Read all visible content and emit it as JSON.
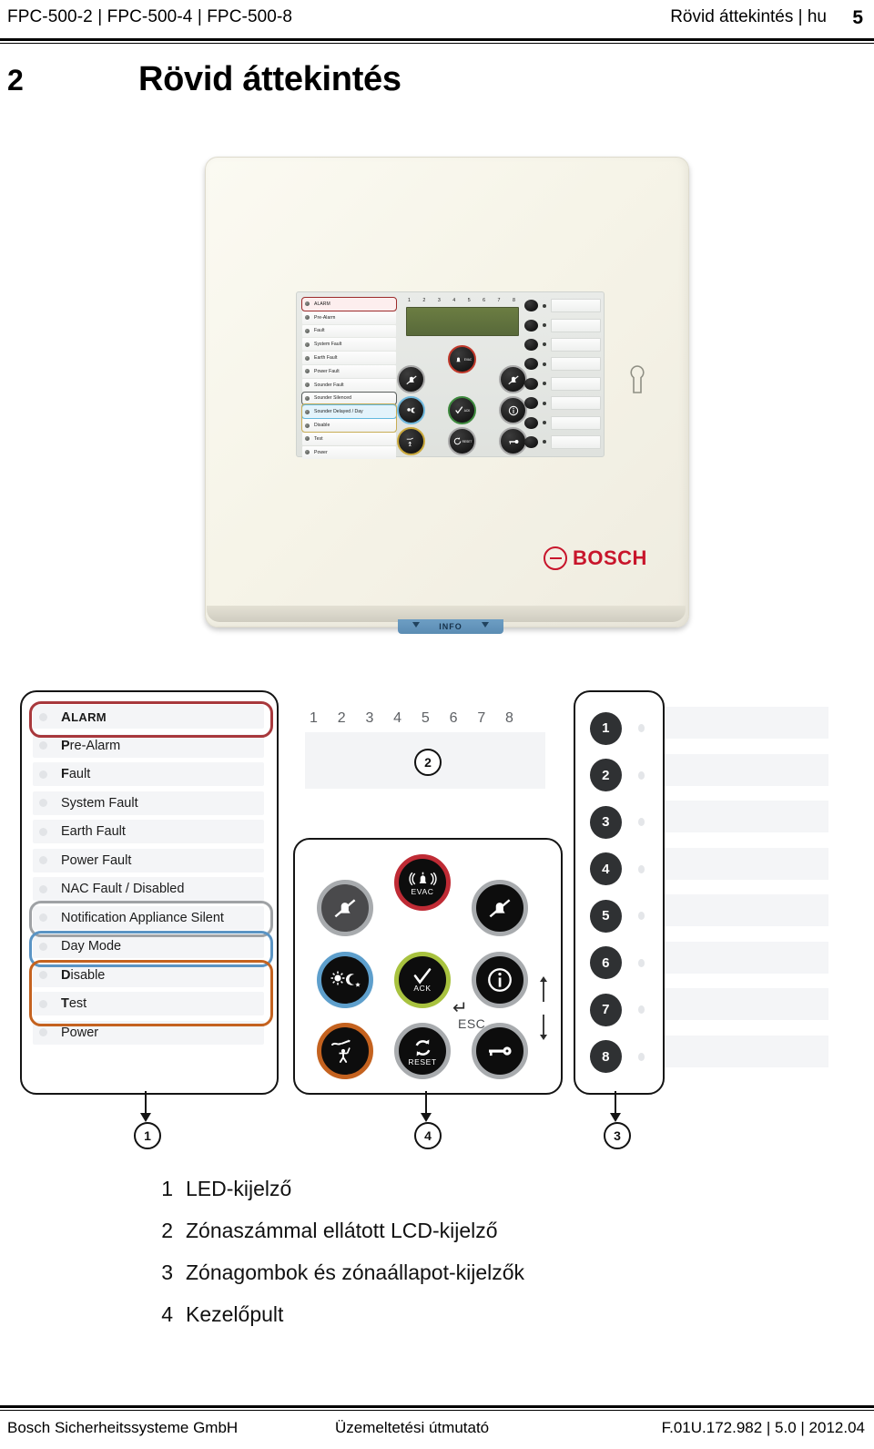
{
  "header": {
    "left": "FPC-500-2 | FPC-500-4 | FPC-500-8",
    "right": "Rövid áttekintés | hu",
    "page": "5"
  },
  "chapter": {
    "number": "2",
    "title": "Rövid áttekintés"
  },
  "photo": {
    "brand": "BOSCH",
    "info_label": "INFO",
    "led_labels": [
      "ALARM",
      "Pre-Alarm",
      "Fault",
      "System Fault",
      "Earth Fault",
      "Power Fault",
      "Sounder Fault",
      "Sounder Silenced",
      "Sounder Delayed / Day",
      "Disable",
      "Test",
      "Power"
    ],
    "zone_numbers": [
      "1",
      "2",
      "3",
      "4",
      "5",
      "6",
      "7",
      "8"
    ],
    "key_labels": [
      "EVAC",
      "ACK",
      "RESET"
    ]
  },
  "diagram": {
    "leds": [
      {
        "label": "ALARM",
        "style": "caps",
        "highlight": "red"
      },
      {
        "label": "Pre-Alarm",
        "bold_prefix": "P",
        "rest": "re-Alarm"
      },
      {
        "label": "Fault",
        "bold_prefix": "F",
        "rest": "ault"
      },
      {
        "label": "System Fault"
      },
      {
        "label": "Earth Fault"
      },
      {
        "label": "Power Fault"
      },
      {
        "label": "NAC Fault / Disabled"
      },
      {
        "label": "Notification Appliance Silent",
        "highlight": "gray"
      },
      {
        "label": "Day Mode",
        "highlight": "blue"
      },
      {
        "label": "Disable",
        "bold_prefix": "D",
        "rest": "isable",
        "highlight": "orange"
      },
      {
        "label": "Test",
        "bold_prefix": "T",
        "rest": "est",
        "highlight": "orange"
      },
      {
        "label": "Power"
      }
    ],
    "lcd_zone_numbers": [
      "1",
      "2",
      "3",
      "4",
      "5",
      "6",
      "7",
      "8"
    ],
    "lcd_callout": "2",
    "keypad": {
      "buttons": [
        {
          "pos": "r1c1",
          "icon": "sounder-off-icon",
          "caption": "",
          "ring": "gray",
          "fill": "gray"
        },
        {
          "pos": "r1c2",
          "icon": "evac-bell-icon",
          "caption": "EVAC",
          "ring": "red",
          "fill": "black"
        },
        {
          "pos": "r1c3",
          "icon": "mute-icon",
          "caption": "",
          "ring": "gray",
          "fill": "black"
        },
        {
          "pos": "r2c1",
          "icon": "day-night-icon",
          "caption": "",
          "ring": "blue",
          "fill": "black"
        },
        {
          "pos": "r2c2",
          "icon": "check-icon",
          "caption": "ACK",
          "ring": "green",
          "fill": "black"
        },
        {
          "pos": "r2c3",
          "icon": "info-icon",
          "caption": "",
          "ring": "gray",
          "fill": "black"
        },
        {
          "pos": "r3c1",
          "icon": "test-person-icon",
          "caption": "",
          "ring": "orange",
          "fill": "black"
        },
        {
          "pos": "r3c2",
          "icon": "reset-icon",
          "caption": "RESET",
          "ring": "gray",
          "fill": "black"
        },
        {
          "pos": "r3c3",
          "icon": "key-icon",
          "caption": "",
          "ring": "gray",
          "fill": "black"
        }
      ],
      "esc_label": "ESC"
    },
    "zone_buttons": [
      "1",
      "2",
      "3",
      "4",
      "5",
      "6",
      "7",
      "8"
    ],
    "callouts": {
      "led_panel": "1",
      "keypad": "4",
      "zones": "3"
    }
  },
  "legend": [
    {
      "num": "1",
      "text": "LED-kijelző"
    },
    {
      "num": "2",
      "text": "Zónaszámmal ellátott LCD-kijelző"
    },
    {
      "num": "3",
      "text": "Zónagombok és zónaállapot-kijelzők"
    },
    {
      "num": "4",
      "text": "Kezelőpult"
    }
  ],
  "footer": {
    "left": "Bosch Sicherheitssysteme GmbH",
    "middle": "Üzemeltetési útmutató",
    "right": "F.01U.172.982 | 5.0 | 2012.04"
  }
}
